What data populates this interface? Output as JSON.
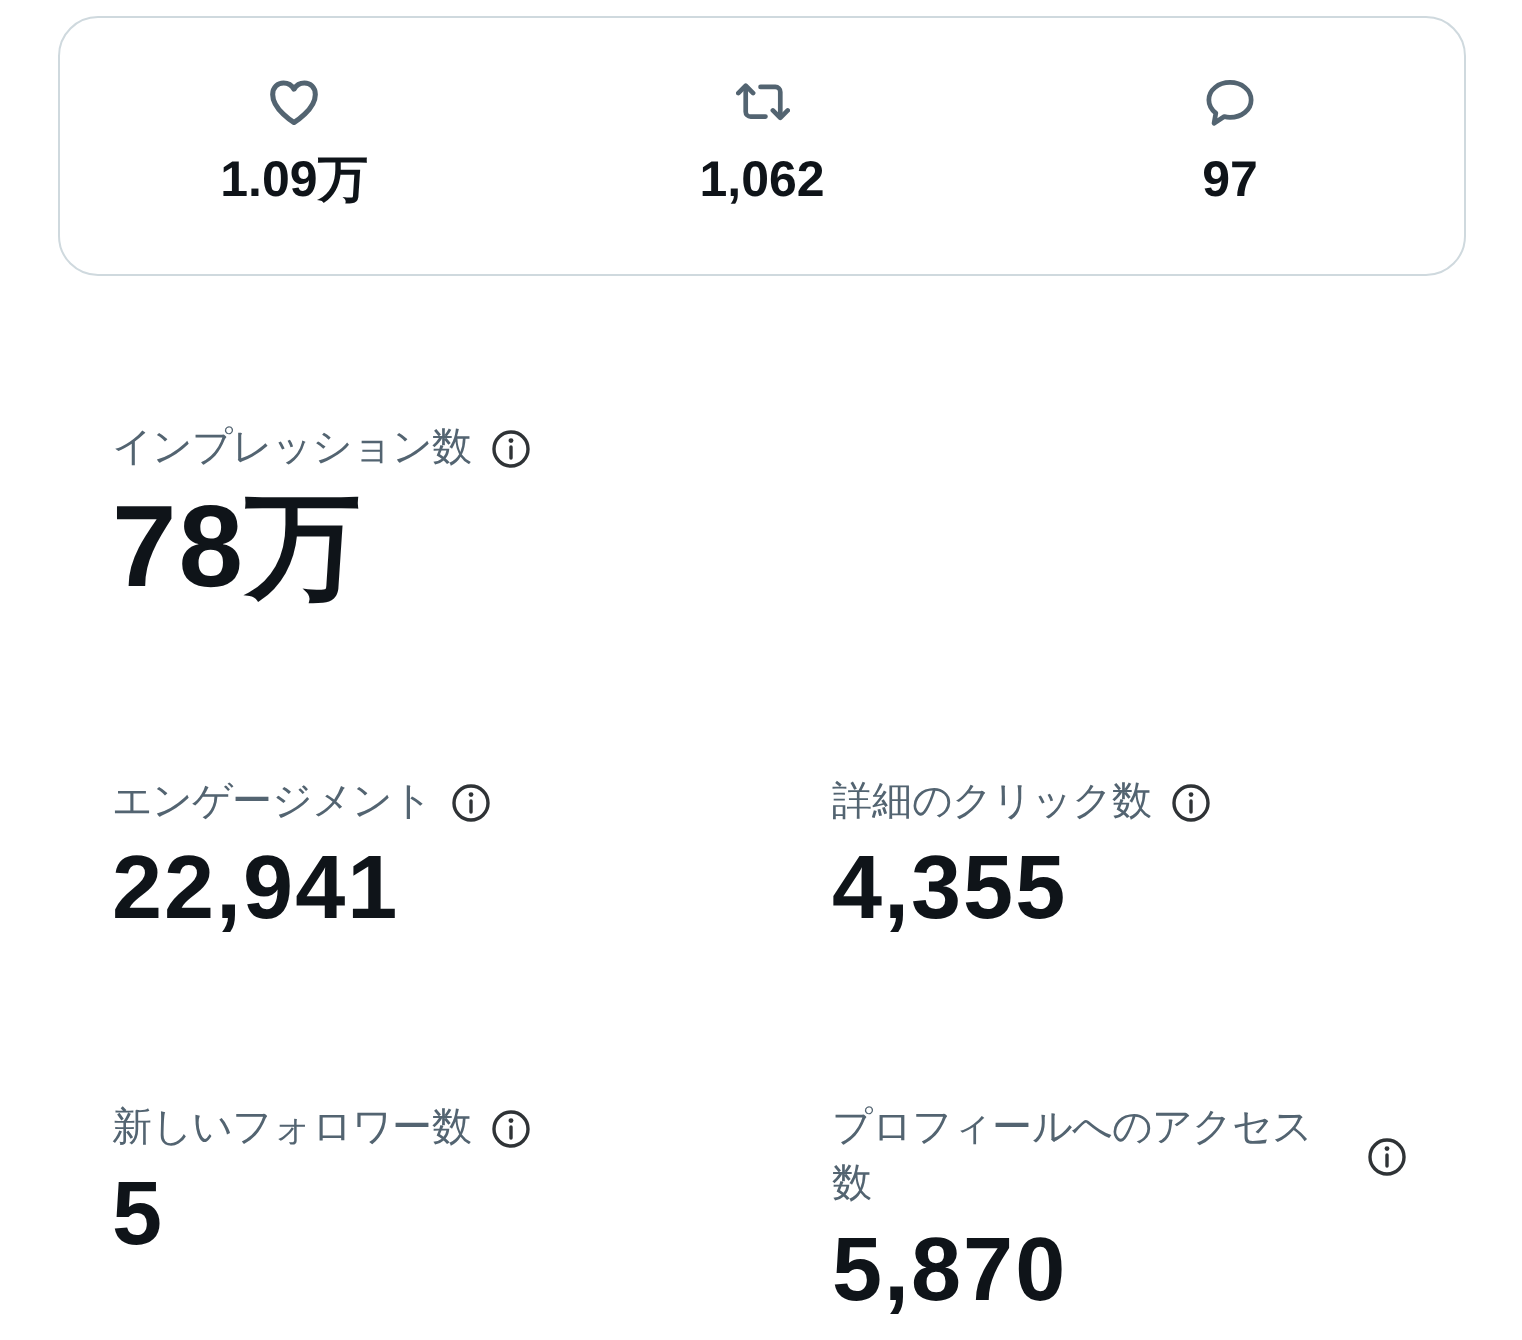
{
  "engagement_bar": {
    "items": [
      {
        "kind": "likes",
        "count": "1.09万"
      },
      {
        "kind": "reposts",
        "count": "1,062"
      },
      {
        "kind": "replies",
        "count": "97"
      }
    ]
  },
  "impressions": {
    "label": "インプレッション数",
    "value": "78万"
  },
  "metrics": [
    {
      "label": "エンゲージメント",
      "value": "22,941"
    },
    {
      "label": "詳細のクリック数",
      "value": "4,355"
    },
    {
      "label": "新しいフォロワー数",
      "value": "5"
    },
    {
      "label": "プロフィールへのアクセス数",
      "value": "5,870"
    }
  ]
}
